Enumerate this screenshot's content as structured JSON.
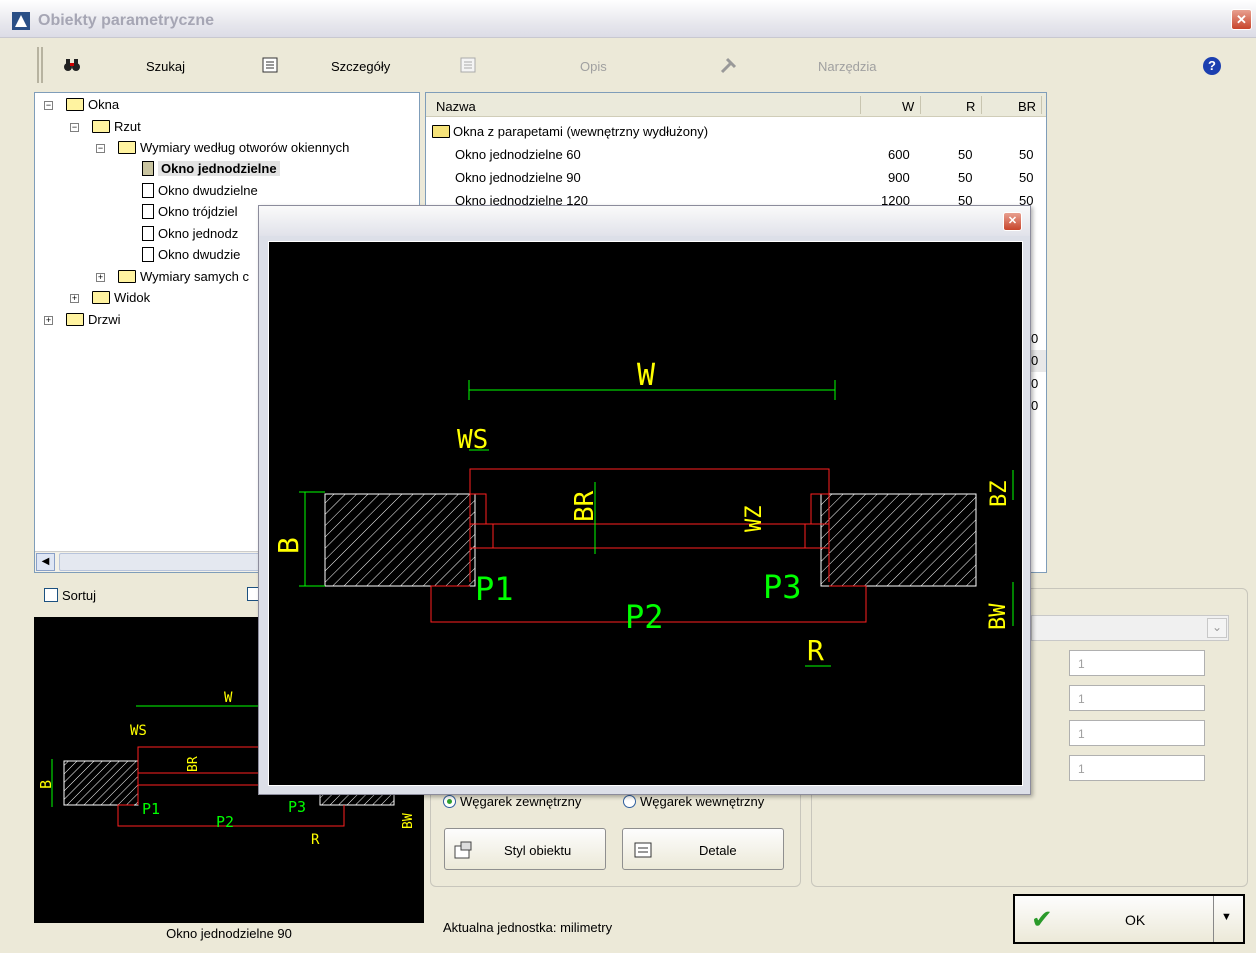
{
  "window": {
    "title": "Obiekty parametryczne",
    "close_glyph": "✕"
  },
  "toolbar": {
    "search_label": "Szukaj",
    "details_label": "Szczegóły",
    "description_label": "Opis",
    "tools_label": "Narzędzia",
    "help_glyph": "?"
  },
  "tree": {
    "expand_plus": "+",
    "collapse_minus": "−",
    "items": [
      {
        "label": "Okna"
      },
      {
        "label": "Rzut"
      },
      {
        "label": "Wymiary według otworów okiennych"
      },
      {
        "label": "Okno jednodzielne"
      },
      {
        "label": "Okno dwudzielne"
      },
      {
        "label": "Okno trójdziel"
      },
      {
        "label": "Okno jednodz"
      },
      {
        "label": "Okno dwudzie"
      },
      {
        "label": "Wymiary samych c"
      },
      {
        "label": "Widok"
      },
      {
        "label": "Drzwi"
      }
    ]
  },
  "table": {
    "columns": [
      "Nazwa",
      "W",
      "R",
      "BR"
    ],
    "group_label": "Okna z parapetami (wewnętrzny wydłużony)",
    "rows": [
      {
        "name": "Okno jednodzielne  60",
        "w": "600",
        "r": "50",
        "br": "50"
      },
      {
        "name": "Okno jednodzielne  90",
        "w": "900",
        "r": "50",
        "br": "50"
      },
      {
        "name": "Okno jednodzielne  120",
        "w": "1200",
        "r": "50",
        "br": "50"
      }
    ],
    "partial_digit": "0"
  },
  "sort": {
    "label": "Sortuj"
  },
  "preview": {
    "caption": "Okno jednodzielne  90",
    "labels": {
      "w": "W",
      "ws": "WS",
      "br": "BR",
      "b": "B",
      "p1": "P1",
      "p2": "P2",
      "p3": "P3",
      "bw": "BW",
      "r": "R"
    }
  },
  "popup": {
    "close_glyph": "✕",
    "labels": {
      "w": "W",
      "ws": "WS",
      "br": "BR",
      "wz": "WZ",
      "bz": "BZ",
      "b": "B",
      "p1": "P1",
      "p2": "P2",
      "p3": "P3",
      "bw": "BW",
      "r": "R"
    }
  },
  "options": {
    "radio_outer": "Węgarek zewnętrzny",
    "radio_inner": "Węgarek wewnętrzny",
    "style_button": "Styl obiektu",
    "details_button": "Detale"
  },
  "params": {
    "values": [
      "1",
      "1",
      "1",
      "1"
    ],
    "dropdown_glyph": "⌄"
  },
  "status": {
    "unit_text": "Aktualna jednostka: milimetry"
  },
  "ok": {
    "label": "OK",
    "check_glyph": "✔",
    "arrow_glyph": "▼"
  },
  "colors": {
    "drawing_bg": "#000000",
    "green": "#00ff00",
    "yellow": "#ffff00",
    "red": "#ff2020",
    "white": "#ffffff"
  }
}
